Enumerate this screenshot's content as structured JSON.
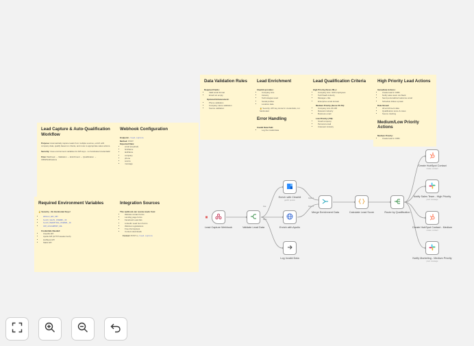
{
  "notes": {
    "validation": {
      "title": "Data Validation Rules",
      "h1": "Required Fields:",
      "items1": [
        "Valid email format",
        "Email not empty"
      ],
      "h2": "Optional Enhancement:",
      "items2": [
        "Phone validation",
        "Company name validation",
        "Source validation"
      ]
    },
    "enrichment": {
      "title": "Lead Enrichment",
      "h1": "Clearbit provides:",
      "items1": [
        "Company size",
        "Industry",
        "Technologies used",
        "Social profiles",
        "Location data"
      ],
      "security": "🔒 Security: API key stored in credentials, not hardcoded",
      "title2": "Error Handling",
      "h2": "Invalid Data Path:",
      "items2": [
        "Log the invalid data"
      ]
    },
    "qualification": {
      "title": "Lead Qualification Criteria",
      "h1": "High Priority (Score 80+):",
      "items1": [
        "Company size >100 employees",
        "Tech/SaaS industry",
        "Manager+ title",
        "Enterprise email domain"
      ],
      "h2": "Medium Priority (Score 50-79):",
      "items2": [
        "Company size 20-100",
        "Relevant industry",
        "Business email"
      ],
      "h3": "Low Priority (<50):",
      "items3": [
        "Small company",
        "Personal email",
        "Irrelevant industry"
      ]
    },
    "high_actions": {
      "title": "High Priority Lead Actions",
      "h1": "Immediate Actions:",
      "items1": [
        "Create lead in CRM",
        "Notify sales team via Slack",
        "Send personalized welcome email",
        "Schedule follow-up task"
      ],
      "h2": "Data Stored:",
      "items2": [
        "All enrichment data",
        "Qualification score & notes",
        "Source tracking"
      ],
      "title2": "Medium/Low Priority Actions",
      "h3": "Medium Priority:",
      "items3": [
        "Create lead in CRM"
      ]
    },
    "capture": {
      "title": "Lead Capture & Auto-Qualification Workflow",
      "purpose_label": "Purpose:",
      "purpose": "Automatically capture leads from multiple sources, enrich with company data, qualify based on criteria, and route to appropriate sales actions.",
      "security_label": "Security:",
      "security": "Uses environment variables for API keys - no hardcoded credentials!",
      "flow_label": "Flow:",
      "flow": "Webhook → Validation → Enrichment → Qualification → CRM/Notifications"
    },
    "webhook": {
      "title": "Webhook Configuration",
      "endpoint_label": "Endpoint:",
      "endpoint": "/lead-capture",
      "method_label": "Method:",
      "method": "POST",
      "expected_label": "Expected Data:",
      "items": [
        "email (required)",
        "firstName",
        "lastName",
        "company",
        "phone",
        "source",
        "message"
      ]
    },
    "env": {
      "title": "Required Environment Variables",
      "security": "🔒 Security - No Hardcoded Keys!",
      "vars": [
        "APOLLO_API_KEY",
        "SLACK_SALES_CHANNEL_ID",
        "SLACK_MARKETING_CHANNEL_ID",
        "CRM_ASSIGNMENT_URL"
      ],
      "h2": "Credentials Needed:",
      "items2": [
        "Clearbit API",
        "Apollo API (HTTP Header Auth)",
        "HubSpot API",
        "Slack API"
      ]
    },
    "sources": {
      "title": "Integration Sources",
      "h1": "This webhook can receive leads from:",
      "items1": [
        "Website contact forms",
        "Landing page forms",
        "Facebook Lead Ads",
        "LinkedIn Lead Gen Forms",
        "Webinar registrations",
        "Free trial signups",
        "Content downloads"
      ],
      "format_label": "Format:",
      "format_pre": "POST to",
      "format_code": "/lead-capture"
    }
  },
  "nodes": {
    "webhook": {
      "label": "Lead Capture Webhook",
      "icon": "webhook-icon"
    },
    "validate": {
      "label": "Validate Lead Data",
      "icon": "if-branch-icon"
    },
    "clearbit": {
      "label": "Enrich with Clearbit",
      "sub": "getAll: person",
      "icon": "clearbit-icon"
    },
    "apollo": {
      "label": "Enrich with Apollo",
      "icon": "globe-icon"
    },
    "log": {
      "label": "Log Invalid Data",
      "icon": "arrow-right-icon"
    },
    "merge": {
      "label": "Merge Enrichment Data",
      "icon": "merge-icon"
    },
    "score": {
      "label": "Calculate Lead Score",
      "icon": "code-icon"
    },
    "route": {
      "label": "Route by Qualification",
      "icon": "switch-icon"
    },
    "hs_high": {
      "label": "Create HubSpot Contact",
      "sub": "create: contact",
      "icon": "hubspot-icon"
    },
    "slack_sales": {
      "label": "Notify Sales Team - High Priority",
      "sub": "post: message",
      "icon": "slack-icon"
    },
    "hs_med": {
      "label": "Create HubSpot Contact - Medium",
      "sub": "create: contact",
      "icon": "hubspot-icon"
    },
    "slack_mkt": {
      "label": "Notify Marketing - Medium Priority",
      "sub": "post: message",
      "icon": "slack-icon"
    }
  },
  "edge_labels": {
    "true": "true",
    "false": "false",
    "input1": "Input 1",
    "input2": "Input 2"
  },
  "colors": {
    "note_bg": "#fff6d1",
    "canvas_bg": "#f2f2f2",
    "slack": "#e01e5a",
    "hubspot": "#ff7a59",
    "clearbit": "#2b8cff",
    "webhook": "#c63d5d"
  },
  "controls": [
    {
      "name": "fit-view",
      "icon": "fullscreen-icon"
    },
    {
      "name": "zoom-in",
      "icon": "zoom-in-icon"
    },
    {
      "name": "zoom-out",
      "icon": "zoom-out-icon"
    },
    {
      "name": "reset",
      "icon": "undo-icon"
    }
  ]
}
